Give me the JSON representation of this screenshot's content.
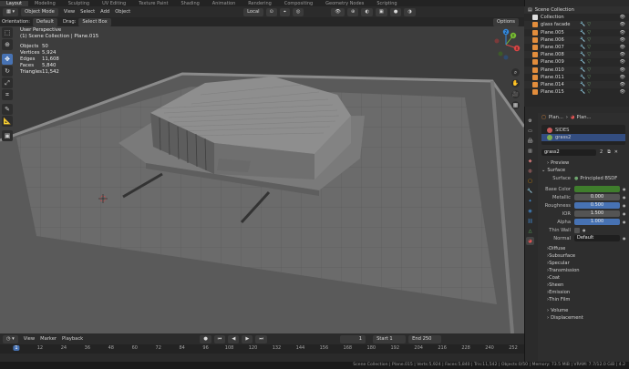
{
  "top_tabs": [
    "Layout",
    "Modeling",
    "Sculpting",
    "UV Editing",
    "Texture Paint",
    "Shading",
    "Animation",
    "Rendering",
    "Compositing",
    "Geometry Nodes",
    "Scripting"
  ],
  "active_top_tab": "Layout",
  "header": {
    "mode": "Object Mode",
    "menus": [
      "View",
      "Select",
      "Add",
      "Object"
    ],
    "transform_space": "Local",
    "options_label": "Options"
  },
  "tool_header": {
    "orientation_label": "Orientation:",
    "orientation_value": "Default",
    "drag_label": "Drag:",
    "drag_value": "Select Box"
  },
  "viewport_overlay": {
    "view_name": "User Perspective",
    "context": "(1) Scene Collection | Plane.015",
    "stats": [
      {
        "label": "Objects",
        "value": "50"
      },
      {
        "label": "Vertices",
        "value": "5,924"
      },
      {
        "label": "Edges",
        "value": "11,608"
      },
      {
        "label": "Faces",
        "value": "5,840"
      },
      {
        "label": "Triangles",
        "value": "11,542"
      }
    ]
  },
  "gizmo": {
    "x": "X",
    "y": "Y",
    "z": "Z"
  },
  "outliner": {
    "title": "Scene Collection",
    "rows": [
      {
        "name": "Collection",
        "icon": "collection-icon",
        "icon_color": "#e0e0e0"
      },
      {
        "name": "glass facade",
        "icon": "mesh-icon",
        "icon_color": "#e28d3c"
      },
      {
        "name": "Plane.005",
        "icon": "mesh-icon",
        "icon_color": "#e28d3c"
      },
      {
        "name": "Plane.006",
        "icon": "mesh-icon",
        "icon_color": "#e28d3c"
      },
      {
        "name": "Plane.007",
        "icon": "mesh-icon",
        "icon_color": "#e28d3c"
      },
      {
        "name": "Plane.008",
        "icon": "mesh-icon",
        "icon_color": "#e28d3c"
      },
      {
        "name": "Plane.009",
        "icon": "mesh-icon",
        "icon_color": "#e28d3c"
      },
      {
        "name": "Plane.010",
        "icon": "mesh-icon",
        "icon_color": "#e28d3c"
      },
      {
        "name": "Plane.011",
        "icon": "mesh-icon",
        "icon_color": "#e28d3c"
      },
      {
        "name": "Plane.014",
        "icon": "mesh-icon",
        "icon_color": "#e28d3c"
      },
      {
        "name": "Plane.015",
        "icon": "mesh-icon",
        "icon_color": "#e28d3c"
      }
    ]
  },
  "properties": {
    "breadcrumb": [
      "Plan...",
      "Plan..."
    ],
    "material_slots": [
      {
        "name": "SIDES",
        "color": "#c75b5b"
      },
      {
        "name": "grass2",
        "color": "#7fae4f"
      }
    ],
    "active_material": "grass2",
    "material_users": "2",
    "sections": {
      "preview": "Preview",
      "surface": "Surface",
      "volume": "Volume",
      "displacement": "Displacement"
    },
    "surface_shader_label": "Surface",
    "surface_shader": "Principled BSDF",
    "fields": [
      {
        "label": "Base Color",
        "value": "",
        "type": "color",
        "color": "#3f7d2c"
      },
      {
        "label": "Metallic",
        "value": "0.000",
        "type": "num"
      },
      {
        "label": "Roughness",
        "value": "0.500",
        "type": "blue"
      },
      {
        "label": "IOR",
        "value": "1.500",
        "type": "num"
      },
      {
        "label": "Alpha",
        "value": "1.000",
        "type": "blue"
      },
      {
        "label": "Thin Wall",
        "value": "",
        "type": "check"
      },
      {
        "label": "Normal",
        "value": "Default",
        "type": "dark"
      }
    ],
    "subsections": [
      "Diffuse",
      "Subsurface",
      "Specular",
      "Transmission",
      "Coat",
      "Sheen",
      "Emission",
      "Thin Film"
    ]
  },
  "timeline": {
    "menus": [
      "View",
      "Marker",
      "Playback"
    ],
    "current_frame": "1",
    "start_label": "Start",
    "start": "1",
    "end_label": "End",
    "end": "250",
    "ticks": [
      "1",
      "12",
      "24",
      "36",
      "48",
      "60",
      "72",
      "84",
      "96",
      "108",
      "120",
      "132",
      "144",
      "156",
      "168",
      "180",
      "192",
      "204",
      "216",
      "228",
      "240",
      "252"
    ]
  },
  "statusbar": "Scene Collection | Plane.015 | Verts:5,924 | Faces:5,840 | Tris:11,542 | Objects:0/50 | Memory: 73.5 MiB | VRAM: 7.7/12.0 GiB | 4.2"
}
